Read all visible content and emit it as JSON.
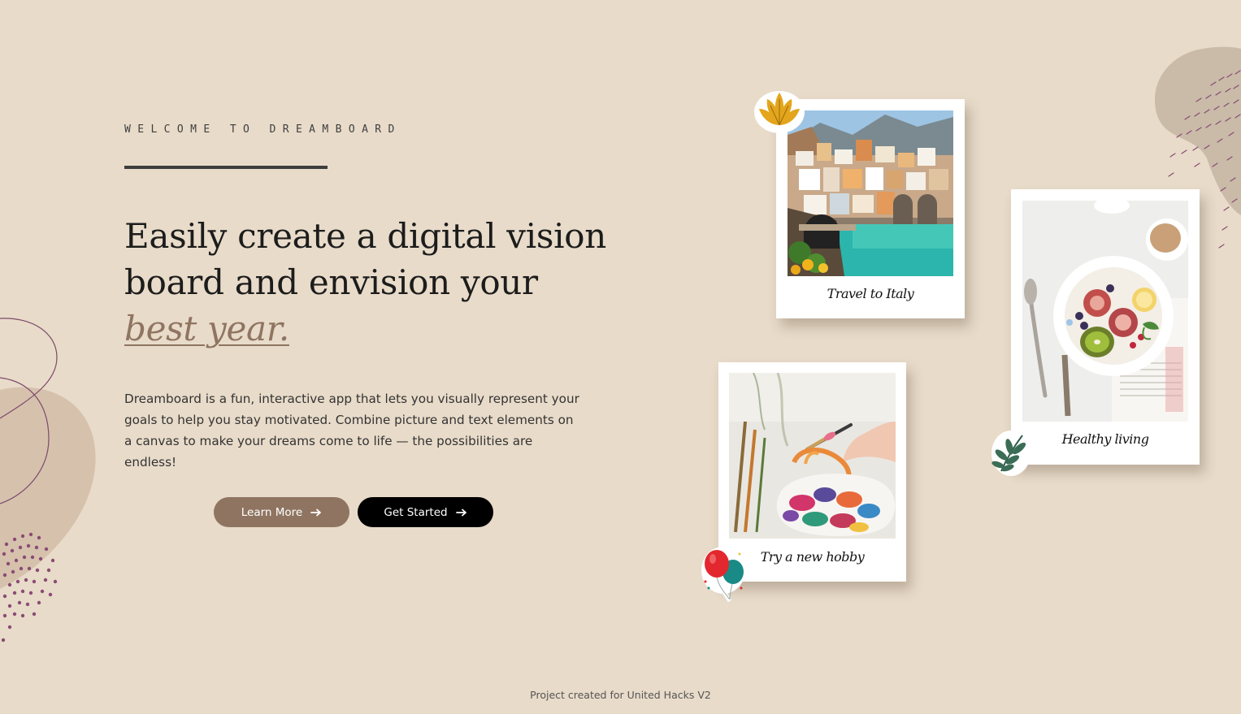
{
  "hero": {
    "eyebrow": "WELCOME TO DREAMBOARD",
    "headline_main": "Easily create a digital vision board and envision your ",
    "headline_emphasis": "best year.",
    "description": "Dreamboard is a fun, interactive app that lets you visually represent your goals to help you stay motivated. Combine picture and text elements on a canvas to make your dreams come to life — the possibilities are endless!"
  },
  "buttons": {
    "learn_more": "Learn More",
    "get_started": "Get Started"
  },
  "polaroids": {
    "italy": "Travel to Italy",
    "healthy": "Healthy living",
    "hobby": "Try a new hobby"
  },
  "footer": {
    "text": "Project created for United Hacks V2"
  },
  "colors": {
    "background": "#e8dbc9",
    "accent": "#8f7561",
    "dark": "#000000"
  },
  "icons": [
    "arrow-right-icon",
    "leaf-sticker-icon",
    "fern-sticker-icon",
    "balloons-sticker-icon"
  ]
}
